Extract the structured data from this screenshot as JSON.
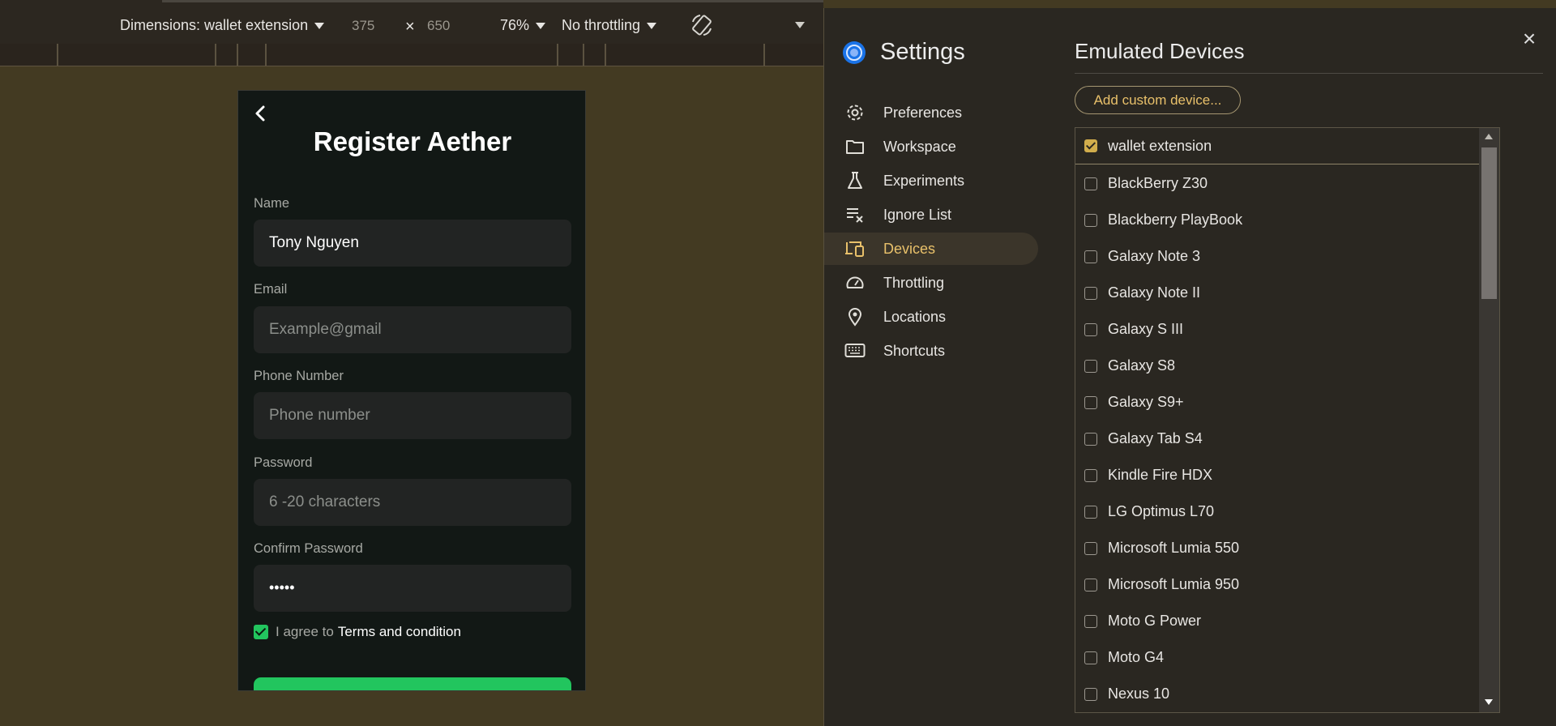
{
  "toolbar": {
    "dimensions_label": "Dimensions: wallet extension",
    "width": "375",
    "height": "650",
    "times": "×",
    "zoom": "76%",
    "throttling": "No throttling"
  },
  "phone": {
    "title": "Register Aether",
    "fields": [
      {
        "label": "Name",
        "value": "Tony Nguyen",
        "filled": true
      },
      {
        "label": "Email",
        "value": "Example@gmail",
        "filled": false
      },
      {
        "label": "Phone Number",
        "value": "Phone number",
        "filled": false
      },
      {
        "label": "Password",
        "value": "6 -20 characters",
        "filled": false
      },
      {
        "label": "Confirm Password",
        "value": "•••••",
        "filled": true
      }
    ],
    "agree_prefix": "I agree to",
    "agree_link": "Terms and condition",
    "agree_checked": true,
    "accent_color": "#22c55e"
  },
  "settings": {
    "title": "Settings",
    "close_icon": "×",
    "nav": [
      {
        "label": "Preferences",
        "icon": "gear-icon"
      },
      {
        "label": "Workspace",
        "icon": "folder-icon"
      },
      {
        "label": "Experiments",
        "icon": "flask-icon"
      },
      {
        "label": "Ignore List",
        "icon": "ignore-list-icon"
      },
      {
        "label": "Devices",
        "icon": "devices-icon",
        "active": true
      },
      {
        "label": "Throttling",
        "icon": "speedometer-icon"
      },
      {
        "label": "Locations",
        "icon": "location-pin-icon"
      },
      {
        "label": "Shortcuts",
        "icon": "keyboard-icon"
      }
    ],
    "active_color": "#e8c06a"
  },
  "devices": {
    "title": "Emulated Devices",
    "add_button": "Add custom device...",
    "items": [
      {
        "name": "wallet extension",
        "checked": true
      },
      {
        "name": "BlackBerry Z30",
        "checked": false
      },
      {
        "name": "Blackberry PlayBook",
        "checked": false
      },
      {
        "name": "Galaxy Note 3",
        "checked": false
      },
      {
        "name": "Galaxy Note II",
        "checked": false
      },
      {
        "name": "Galaxy S III",
        "checked": false
      },
      {
        "name": "Galaxy S8",
        "checked": false
      },
      {
        "name": "Galaxy S9+",
        "checked": false
      },
      {
        "name": "Galaxy Tab S4",
        "checked": false
      },
      {
        "name": "Kindle Fire HDX",
        "checked": false
      },
      {
        "name": "LG Optimus L70",
        "checked": false
      },
      {
        "name": "Microsoft Lumia 550",
        "checked": false
      },
      {
        "name": "Microsoft Lumia 950",
        "checked": false
      },
      {
        "name": "Moto G Power",
        "checked": false
      },
      {
        "name": "Moto G4",
        "checked": false
      },
      {
        "name": "Nexus 10",
        "checked": false
      }
    ]
  }
}
